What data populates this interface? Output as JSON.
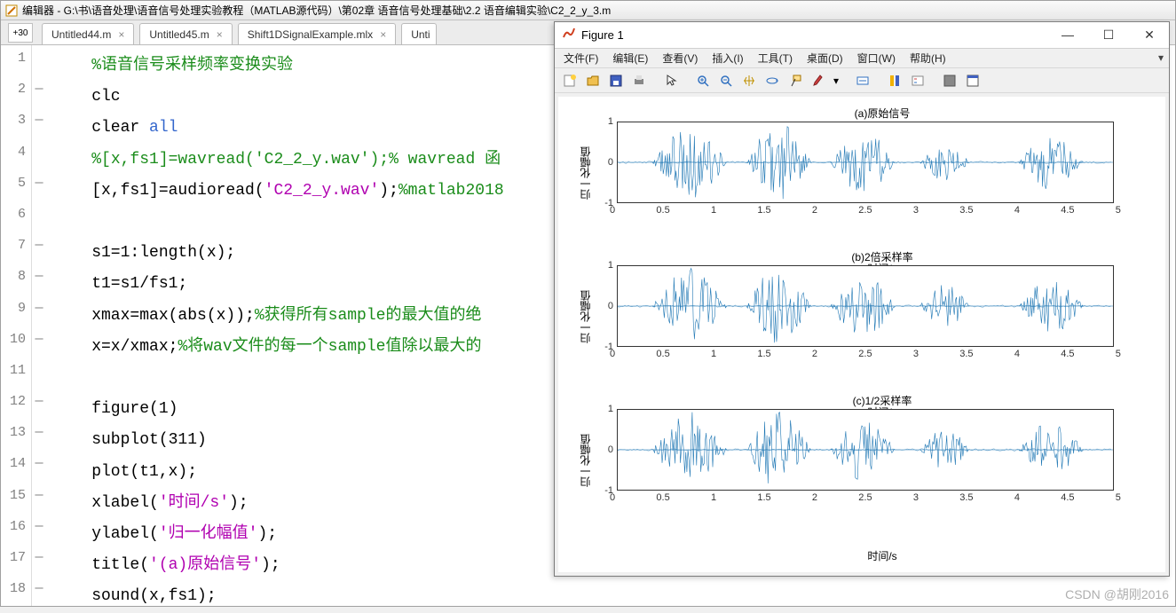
{
  "editor": {
    "title": "编辑器 - G:\\书\\语音处理\\语音信号处理实验教程（MATLAB源代码）\\第02章 语音信号处理基础\\2.2 语音编辑实验\\C2_2_y_3.m",
    "plusLabel": "+30",
    "tabs": [
      {
        "label": "Untitled44.m"
      },
      {
        "label": "Untitled45.m"
      },
      {
        "label": "Shift1DSignalExample.mlx"
      },
      {
        "label": "Unti"
      }
    ],
    "lines": {
      "l1": {
        "num": "1",
        "dash": "",
        "code": "%语音信号采样频率变换实验",
        "cls": "c-comment"
      },
      "l2": {
        "num": "2",
        "dash": "—",
        "code": "clc"
      },
      "l3": {
        "num": "3",
        "dash": "—",
        "pre": "clear ",
        "kw": "all"
      },
      "l4": {
        "num": "4",
        "dash": "",
        "code": "%[x,fs1]=wavread('C2_2_y.wav');% wavread 函",
        "cls": "c-comment"
      },
      "l5": {
        "num": "5",
        "dash": "—",
        "pre": "[x,fs1]=audioread(",
        "str": "'C2_2_y.wav'",
        "post": ");",
        "comment": "%matlab2018"
      },
      "l6": {
        "num": "6",
        "dash": "",
        "code": ""
      },
      "l7": {
        "num": "7",
        "dash": "—",
        "code": "s1=1:length(x);"
      },
      "l8": {
        "num": "8",
        "dash": "—",
        "code": "t1=s1/fs1;"
      },
      "l9": {
        "num": "9",
        "dash": "—",
        "pre": "xmax=max(abs(x));",
        "comment": "%获得所有sample的最大值的绝"
      },
      "l10": {
        "num": "10",
        "dash": "—",
        "pre": "x=x/xmax;",
        "comment": "%将wav文件的每一个sample值除以最大的"
      },
      "l11": {
        "num": "11",
        "dash": "",
        "code": ""
      },
      "l12": {
        "num": "12",
        "dash": "—",
        "code": "figure(1)"
      },
      "l13": {
        "num": "13",
        "dash": "—",
        "code": "subplot(311)"
      },
      "l14": {
        "num": "14",
        "dash": "—",
        "code": "plot(t1,x);"
      },
      "l15": {
        "num": "15",
        "dash": "—",
        "pre": "xlabel(",
        "str": "'时间/s'",
        "post": ");"
      },
      "l16": {
        "num": "16",
        "dash": "—",
        "pre": "ylabel(",
        "str": "'归一化幅值'",
        "post": ");"
      },
      "l17": {
        "num": "17",
        "dash": "—",
        "pre": "title(",
        "str": "'(a)原始信号'",
        "post": ");"
      },
      "l18": {
        "num": "18",
        "dash": "—",
        "code": "sound(x,fs1);"
      }
    }
  },
  "figure": {
    "title": "Figure 1",
    "menus": {
      "file": "文件(F)",
      "edit": "编辑(E)",
      "view": "查看(V)",
      "insert": "插入(I)",
      "tools": "工具(T)",
      "desktop": "桌面(D)",
      "window": "窗口(W)",
      "help": "帮助(H)"
    },
    "subplots": [
      {
        "title": "(a)原始信号",
        "ylabel": "归一化幅值",
        "xlabel": "时间/s"
      },
      {
        "title": "(b)2倍采样率",
        "ylabel": "归一化幅值",
        "xlabel": "时间/s"
      },
      {
        "title": "(c)1/2采样率",
        "ylabel": "归一化幅值",
        "xlabel": "时间/s"
      }
    ],
    "yticks": [
      "1",
      "0",
      "-1"
    ],
    "xticks": [
      "0",
      "0.5",
      "1",
      "1.5",
      "2",
      "2.5",
      "3",
      "3.5",
      "4",
      "4.5",
      "5"
    ]
  },
  "chart_data": {
    "type": "line",
    "description": "Three stacked audio waveform subplots (normalized amplitude vs time). All three look visually identical speech waveforms with ~5 utterance bursts.",
    "xlabel": "时间/s",
    "ylabel": "归一化幅值",
    "xlim": [
      0,
      5
    ],
    "ylim": [
      -1,
      1
    ],
    "xticks": [
      0,
      0.5,
      1,
      1.5,
      2,
      2.5,
      3,
      3.5,
      4,
      4.5,
      5
    ],
    "yticks": [
      -1,
      0,
      1
    ],
    "series": [
      {
        "name": "(a)原始信号",
        "envelope_segments": [
          {
            "start": 0.35,
            "end": 1.1,
            "peak": 0.95
          },
          {
            "start": 1.3,
            "end": 1.95,
            "peak": 1.0
          },
          {
            "start": 2.15,
            "end": 2.8,
            "peak": 0.8
          },
          {
            "start": 3.05,
            "end": 3.55,
            "peak": 0.55
          },
          {
            "start": 4.05,
            "end": 4.7,
            "peak": 0.7
          }
        ]
      },
      {
        "name": "(b)2倍采样率",
        "envelope_segments": [
          {
            "start": 0.35,
            "end": 1.1,
            "peak": 0.95
          },
          {
            "start": 1.3,
            "end": 1.95,
            "peak": 1.0
          },
          {
            "start": 2.15,
            "end": 2.8,
            "peak": 0.8
          },
          {
            "start": 3.05,
            "end": 3.55,
            "peak": 0.55
          },
          {
            "start": 4.05,
            "end": 4.7,
            "peak": 0.7
          }
        ]
      },
      {
        "name": "(c)1/2采样率",
        "envelope_segments": [
          {
            "start": 0.35,
            "end": 1.1,
            "peak": 0.95
          },
          {
            "start": 1.3,
            "end": 1.95,
            "peak": 1.0
          },
          {
            "start": 2.15,
            "end": 2.8,
            "peak": 0.8
          },
          {
            "start": 3.05,
            "end": 3.55,
            "peak": 0.55
          },
          {
            "start": 4.05,
            "end": 4.7,
            "peak": 0.7
          }
        ]
      }
    ]
  },
  "watermark": "CSDN @胡刚2016"
}
